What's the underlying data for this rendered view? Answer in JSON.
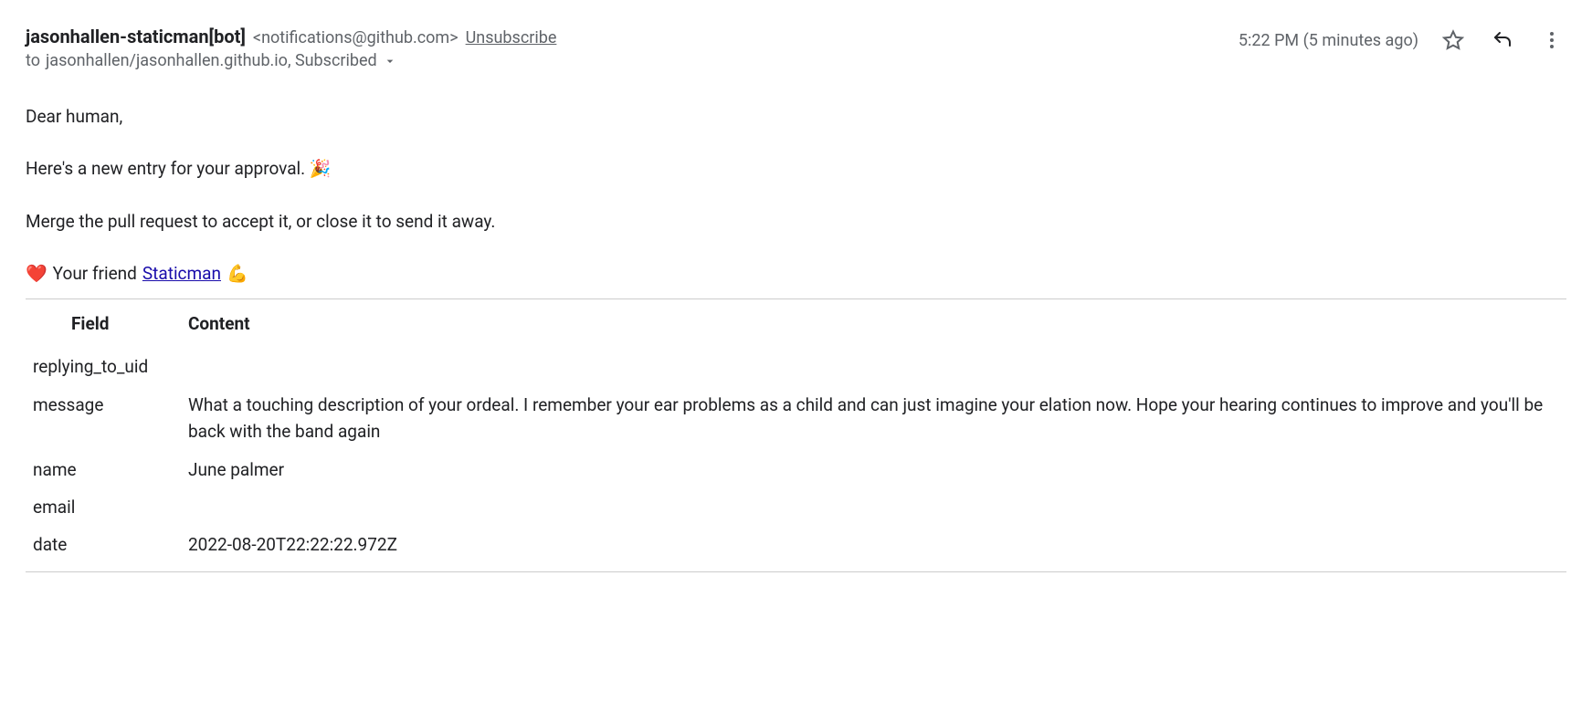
{
  "header": {
    "sender_name": "jasonhallen-staticman[bot]",
    "sender_email": "<notifications@github.com>",
    "unsubscribe": "Unsubscribe",
    "recipient_prefix": "to",
    "recipient": "jasonhallen/jasonhallen.github.io, Subscribed",
    "timestamp": "5:22 PM (5 minutes ago)"
  },
  "body": {
    "greeting": "Dear human,",
    "line1": "Here's a new entry for your approval. 🎉",
    "line2": "Merge the pull request to accept it, or close it to send it away.",
    "signoff_heart": "❤️",
    "signoff_prefix": "Your friend",
    "signoff_link": "Staticman",
    "signoff_flex": "💪"
  },
  "table": {
    "header_field": "Field",
    "header_content": "Content",
    "rows": {
      "replying_to_uid": {
        "field": "replying_to_uid",
        "content": ""
      },
      "message": {
        "field": "message",
        "content": "What a touching description of your ordeal. I remember your ear problems as a child and can just imagine your elation now. Hope your hearing continues to improve and you'll be back with the band again"
      },
      "name": {
        "field": "name",
        "content": "June palmer"
      },
      "email": {
        "field": "email",
        "content": ""
      },
      "date": {
        "field": "date",
        "content": "2022-08-20T22:22:22.972Z"
      }
    }
  }
}
